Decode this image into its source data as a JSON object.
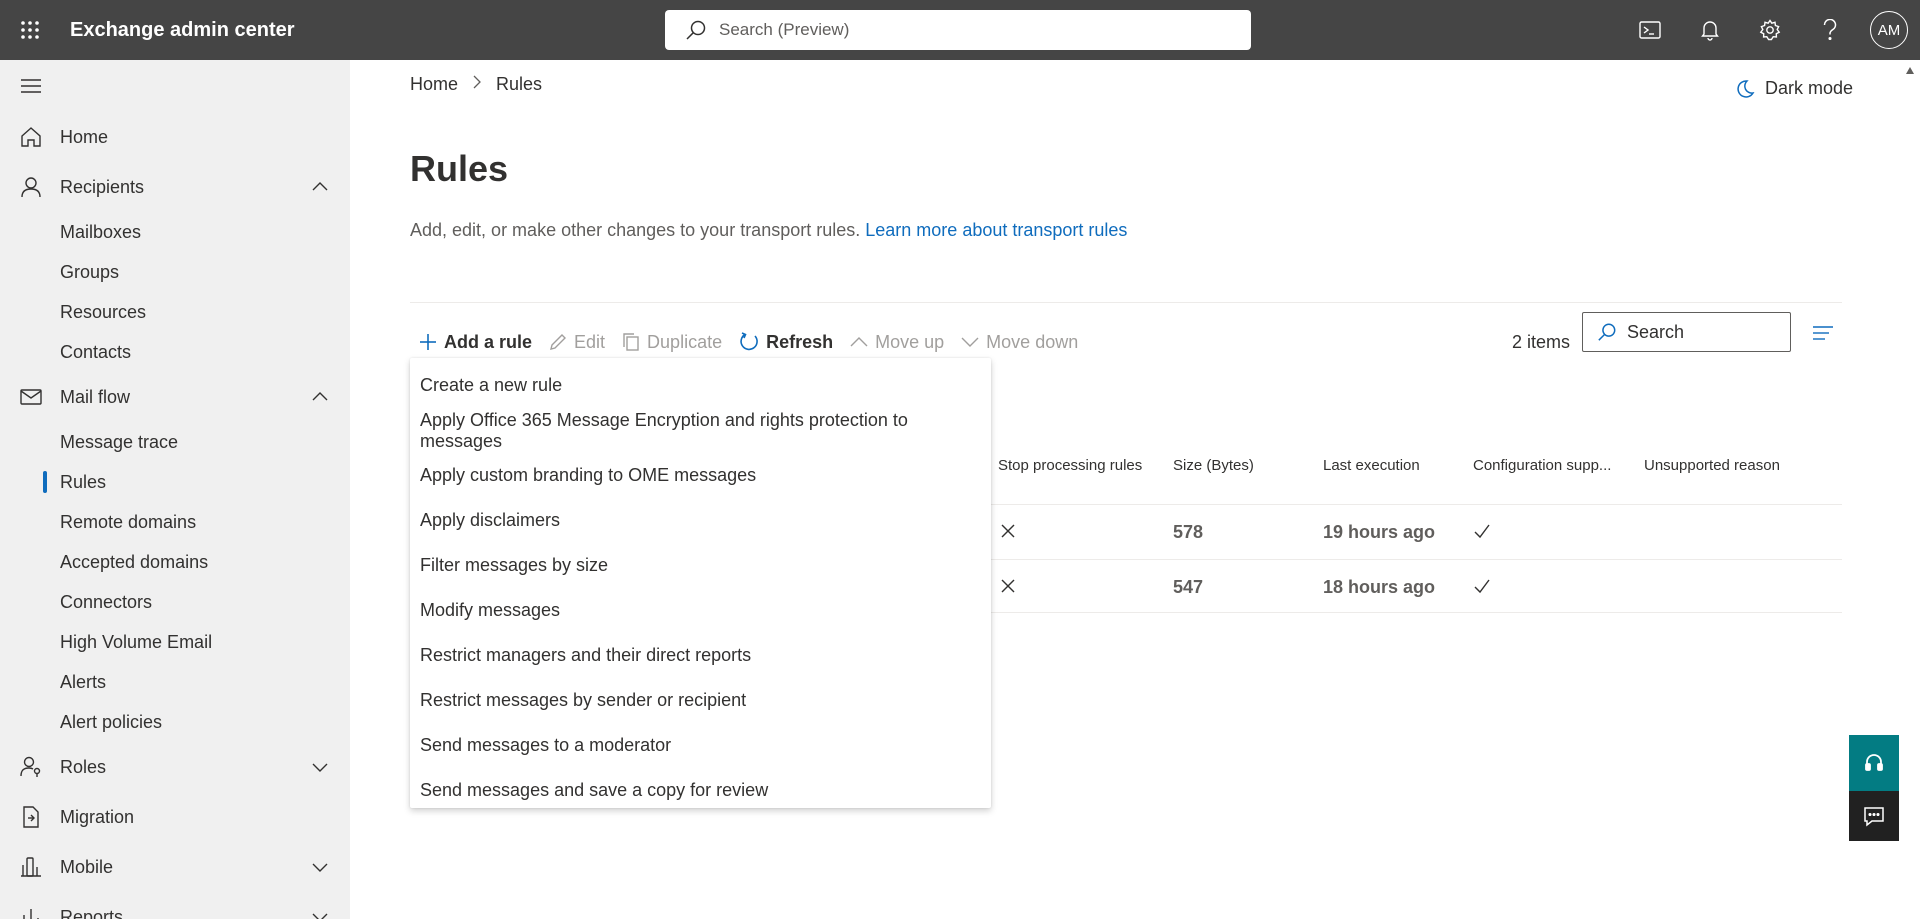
{
  "header": {
    "app_title": "Exchange admin center",
    "search_placeholder": "Search (Preview)",
    "avatar_initials": "AM"
  },
  "sidebar": {
    "items": [
      {
        "label": "Home"
      },
      {
        "label": "Recipients"
      },
      {
        "label": "Mailboxes"
      },
      {
        "label": "Groups"
      },
      {
        "label": "Resources"
      },
      {
        "label": "Contacts"
      },
      {
        "label": "Mail flow"
      },
      {
        "label": "Message trace"
      },
      {
        "label": "Rules"
      },
      {
        "label": "Remote domains"
      },
      {
        "label": "Accepted domains"
      },
      {
        "label": "Connectors"
      },
      {
        "label": "High Volume Email"
      },
      {
        "label": "Alerts"
      },
      {
        "label": "Alert policies"
      },
      {
        "label": "Roles"
      },
      {
        "label": "Migration"
      },
      {
        "label": "Mobile"
      },
      {
        "label": "Reports"
      }
    ]
  },
  "main": {
    "breadcrumb": {
      "home": "Home",
      "separator": ">",
      "current": "Rules"
    },
    "dark_mode_label": "Dark mode",
    "title": "Rules",
    "description": "Add, edit, or make other changes to your transport rules.",
    "learn_more": "Learn more about transport rules",
    "toolbar": {
      "add": "Add a rule",
      "edit": "Edit",
      "duplicate": "Duplicate",
      "refresh": "Refresh",
      "move_up": "Move up",
      "move_down": "Move down"
    },
    "items_count": "2 items",
    "search_placeholder": "Search",
    "columns": [
      "Stop processing rules",
      "Size (Bytes)",
      "Last execution",
      "Configuration supp...",
      "Unsupported reason"
    ],
    "rows": [
      {
        "size": "578",
        "last_execution": "19 hours ago"
      },
      {
        "size": "547",
        "last_execution": "18 hours ago"
      }
    ],
    "add_menu": [
      "Create a new rule",
      "Apply Office 365 Message Encryption and rights protection to messages",
      "Apply custom branding to OME messages",
      "Apply disclaimers",
      "Filter messages by size",
      "Modify messages",
      "Restrict managers and their direct reports",
      "Restrict messages by sender or recipient",
      "Send messages to a moderator",
      "Send messages and save a copy for review"
    ]
  },
  "colors": {
    "topbar": "#454545",
    "accent": "#0f6cbd",
    "sidebar": "#f0f0f0",
    "help": "#037c83"
  }
}
